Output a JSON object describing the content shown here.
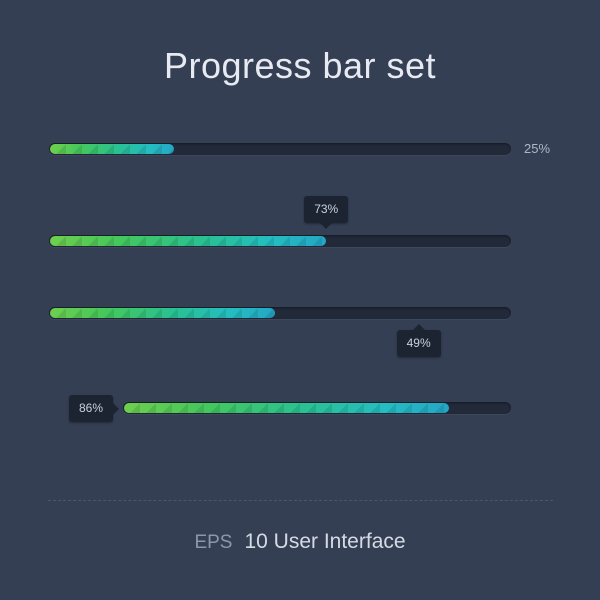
{
  "title": "Progress bar set",
  "bars": [
    {
      "percent": 25,
      "label": "25%",
      "style": "side",
      "fillPercent": 27
    },
    {
      "percent": 73,
      "label": "73%",
      "style": "tooltip-above",
      "fillPercent": 60
    },
    {
      "percent": 49,
      "label": "49%",
      "style": "tooltip-below",
      "fillPercent": 49
    },
    {
      "percent": 86,
      "label": "86%",
      "style": "tooltip-left",
      "fillPercent": 84
    }
  ],
  "footer": {
    "eps": "EPS",
    "text": "10 User Interface"
  }
}
